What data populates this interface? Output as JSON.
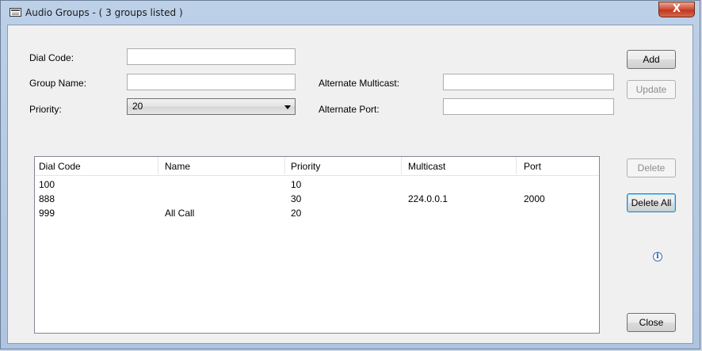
{
  "window": {
    "title": "Audio Groups - ( 3 groups listed )",
    "close_label": "X"
  },
  "form": {
    "dial_code_label": "Dial Code:",
    "dial_code_value": "",
    "group_name_label": "Group Name:",
    "group_name_value": "",
    "priority_label": "Priority:",
    "priority_value": "20",
    "alt_multicast_label": "Alternate Multicast:",
    "alt_multicast_value": "",
    "alt_port_label": "Alternate Port:",
    "alt_port_value": ""
  },
  "buttons": {
    "add": "Add",
    "update": "Update",
    "delete": "Delete",
    "delete_all": "Delete All",
    "close": "Close"
  },
  "list": {
    "columns": [
      "Dial Code",
      "Name",
      "Priority",
      "Multicast",
      "Port"
    ],
    "rows": [
      [
        "100",
        "",
        "10",
        "",
        ""
      ],
      [
        "888",
        "",
        "30",
        "224.0.0.1",
        "2000"
      ],
      [
        "999",
        "All Call",
        "20",
        "",
        ""
      ]
    ]
  },
  "icons": {
    "window_icon": "window-icon",
    "close_icon": "close-icon",
    "info_icon": "info-icon",
    "dropdown_icon": "chevron-down-icon"
  },
  "info_glyph": "i"
}
